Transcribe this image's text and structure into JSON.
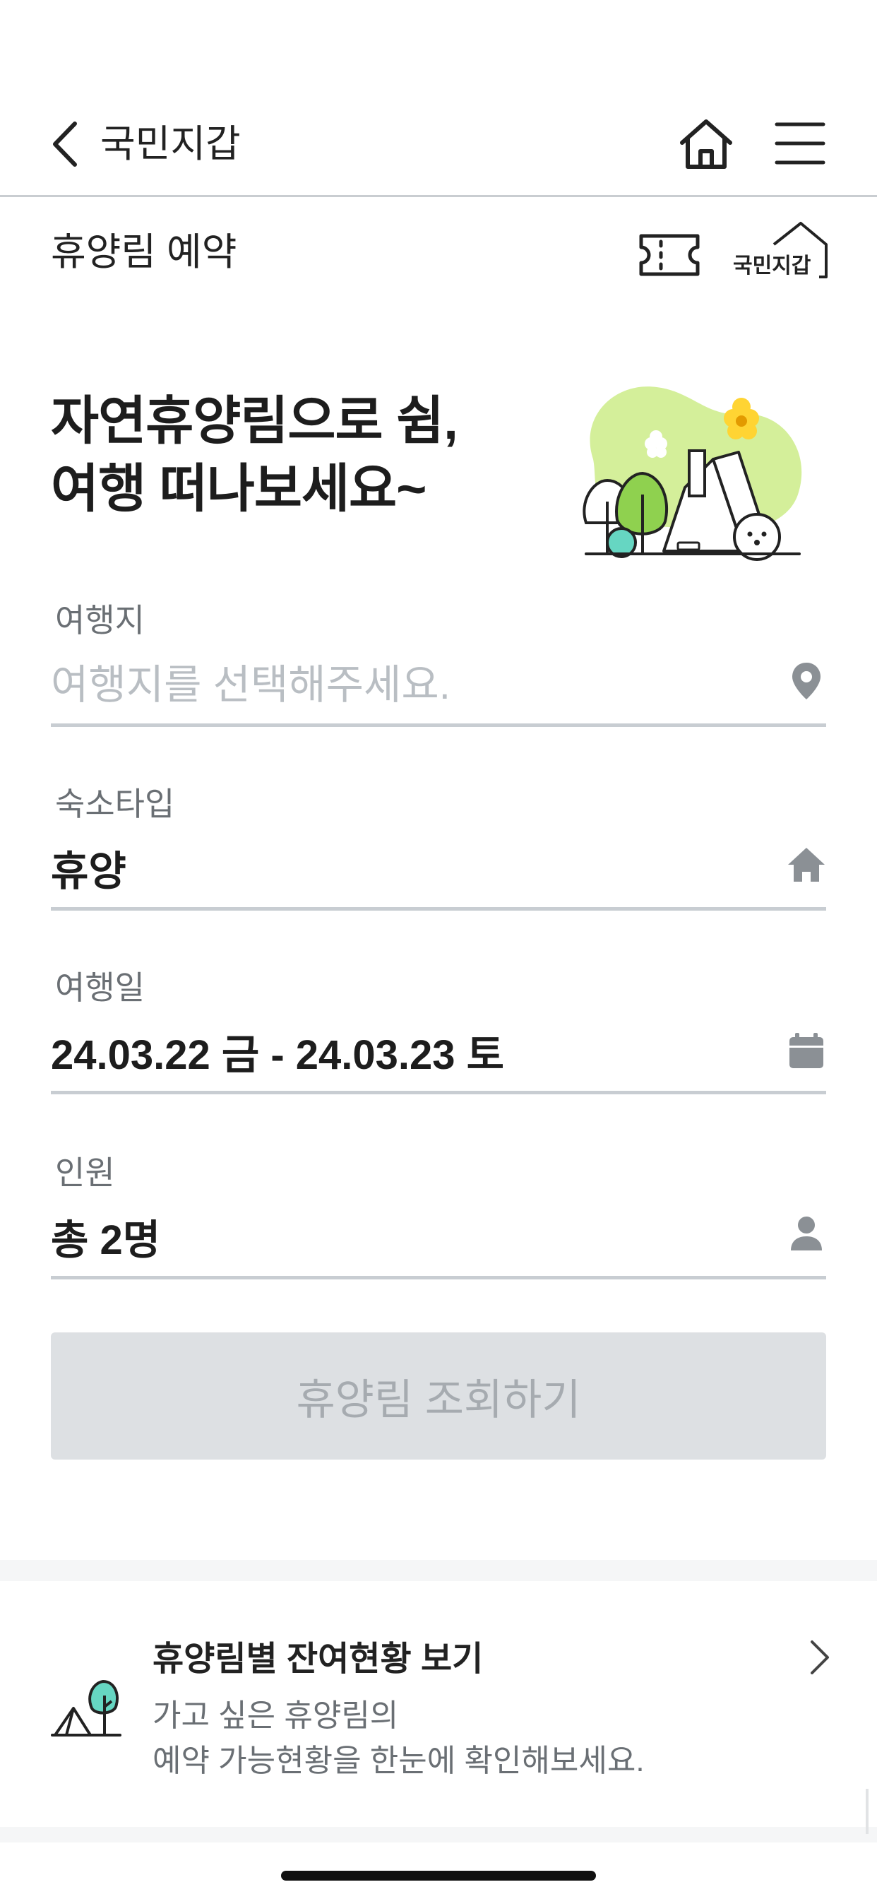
{
  "appbar": {
    "title": "국민지갑",
    "back_icon": "chevron-left-icon",
    "home_icon": "home-icon",
    "menu_icon": "hamburger-menu-icon"
  },
  "subheader": {
    "title": "휴양림 예약",
    "ticket_icon": "ticket-icon",
    "logo_text": "국민지갑"
  },
  "hero": {
    "line1": "자연휴양림으로 쉼,",
    "line2": "여행 떠나보세요~"
  },
  "form": {
    "destination": {
      "label": "여행지",
      "placeholder": "여행지를 선택해주세요.",
      "icon": "location-pin-icon"
    },
    "lodging_type": {
      "label": "숙소타입",
      "value": "휴양",
      "icon": "house-icon"
    },
    "travel_date": {
      "label": "여행일",
      "value": "24.03.22 금 - 24.03.23 토",
      "icon": "calendar-icon"
    },
    "guests": {
      "label": "인원",
      "value": "총 2명",
      "icon": "person-icon"
    }
  },
  "search_button": {
    "label": "휴양림 조회하기"
  },
  "promo": {
    "title": "휴양림별 잔여현황 보기",
    "desc_line1": "가고 싶은 휴양림의",
    "desc_line2": "예약 가능현황을 한눈에 확인해보세요.",
    "icon": "tent-tree-icon",
    "arrow_icon": "chevron-right-icon"
  },
  "colors": {
    "text_primary": "#1d1d1d",
    "text_secondary": "#6a6f74",
    "placeholder": "#b9bec3",
    "divider": "#c8cdd2",
    "button_disabled_bg": "#dde0e3",
    "button_disabled_text": "#a6abb0",
    "accent_green": "#d4ef9a",
    "accent_teal": "#66d6c2",
    "accent_yellow": "#ffd433"
  }
}
